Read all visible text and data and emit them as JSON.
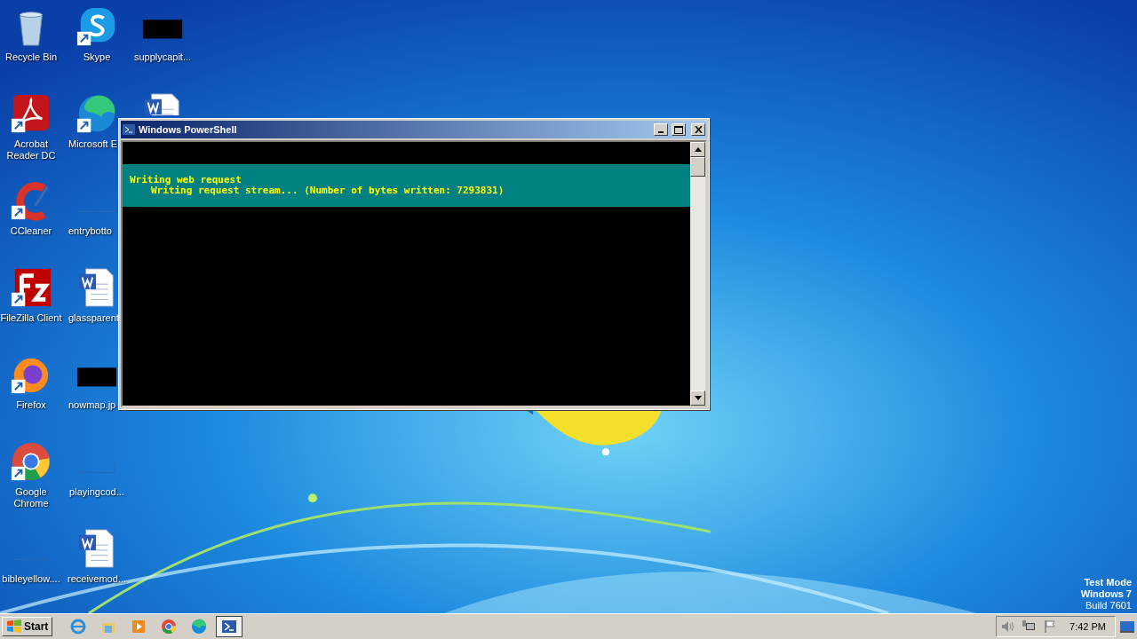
{
  "desktop_icons": [
    {
      "label": "Recycle Bin",
      "kind": "recycle",
      "shortcut": false
    },
    {
      "label": "Acrobat Reader DC",
      "kind": "pdf",
      "shortcut": true
    },
    {
      "label": "CCleaner",
      "kind": "ccleaner",
      "shortcut": true
    },
    {
      "label": "FileZilla Client",
      "kind": "filezilla",
      "shortcut": true
    },
    {
      "label": "Firefox",
      "kind": "firefox",
      "shortcut": true
    },
    {
      "label": "Google Chrome",
      "kind": "chrome",
      "shortcut": true
    },
    {
      "label": "bibleyellow....",
      "kind": "thumb-line",
      "shortcut": false
    },
    {
      "label": "Skype",
      "kind": "skype",
      "shortcut": true
    },
    {
      "label": "Microsoft E",
      "kind": "edge",
      "shortcut": true,
      "covered": true
    },
    {
      "label": "entrybotto",
      "kind": "thumb-line",
      "shortcut": false,
      "covered": true
    },
    {
      "label": "glassparent",
      "kind": "word",
      "shortcut": false,
      "covered": true
    },
    {
      "label": "nowmap.jp",
      "kind": "thumb-dark",
      "shortcut": false,
      "covered": true
    },
    {
      "label": "playingcod...",
      "kind": "thumb-line",
      "shortcut": false
    },
    {
      "label": "receivemod...",
      "kind": "word",
      "shortcut": false
    },
    {
      "label": "supplycapit...",
      "kind": "thumb-dark",
      "shortcut": false
    },
    {
      "kind": "word",
      "shortcut": false,
      "covered": true
    }
  ],
  "window": {
    "title": "Windows PowerShell",
    "progress": {
      "activity": "Writing web request",
      "status": "Writing request stream... (Number of bytes written: 7293831)"
    }
  },
  "watermark_text": [
    "Test Mode",
    "Windows 7",
    "Build 7601"
  ],
  "taskbar": {
    "start": "Start",
    "apps": [
      {
        "kind": "ie",
        "selected": false
      },
      {
        "kind": "explorer",
        "selected": false
      },
      {
        "kind": "media",
        "selected": false
      },
      {
        "kind": "chrome",
        "selected": false
      },
      {
        "kind": "edge",
        "selected": false
      },
      {
        "kind": "powershell",
        "selected": true
      }
    ],
    "clock": "7:42 PM"
  }
}
